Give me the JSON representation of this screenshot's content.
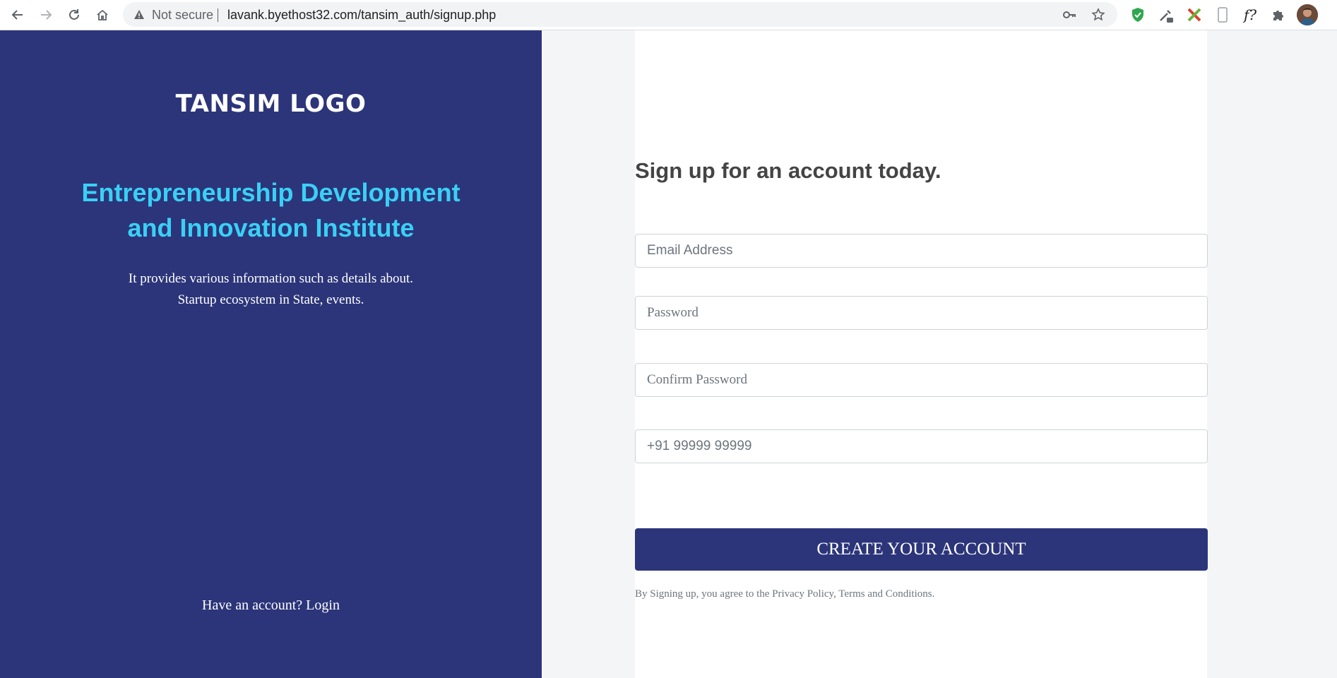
{
  "browser": {
    "security_label": "Not secure",
    "url": "lavank.byethost32.com/tansim_auth/signup.php",
    "extensions": [
      "shield-check-icon",
      "eyedropper-icon",
      "x-mark-icon",
      "mobile-device-icon",
      "font-icon",
      "puzzle-icon"
    ],
    "font_ext_label": "f?"
  },
  "left_panel": {
    "logo": "TANSIM LOGO",
    "tagline": "Entrepreneurship Development and Innovation Institute",
    "description": "It provides various information such as details about. Startup ecosystem in State, events.",
    "have_account": "Have an account?",
    "login_link": "Login",
    "bg_color": "#2c357a",
    "accent_color": "#3ad0f5"
  },
  "form": {
    "heading": "Sign up for an account today.",
    "email_placeholder": "Email Address",
    "password_placeholder": "Password",
    "confirm_password_placeholder": "Confirm Password",
    "phone_placeholder": "+91 99999 99999",
    "submit_label": "CREATE YOUR ACCOUNT",
    "terms": "By Signing up, you agree to the Privacy Policy, Terms and Conditions."
  }
}
